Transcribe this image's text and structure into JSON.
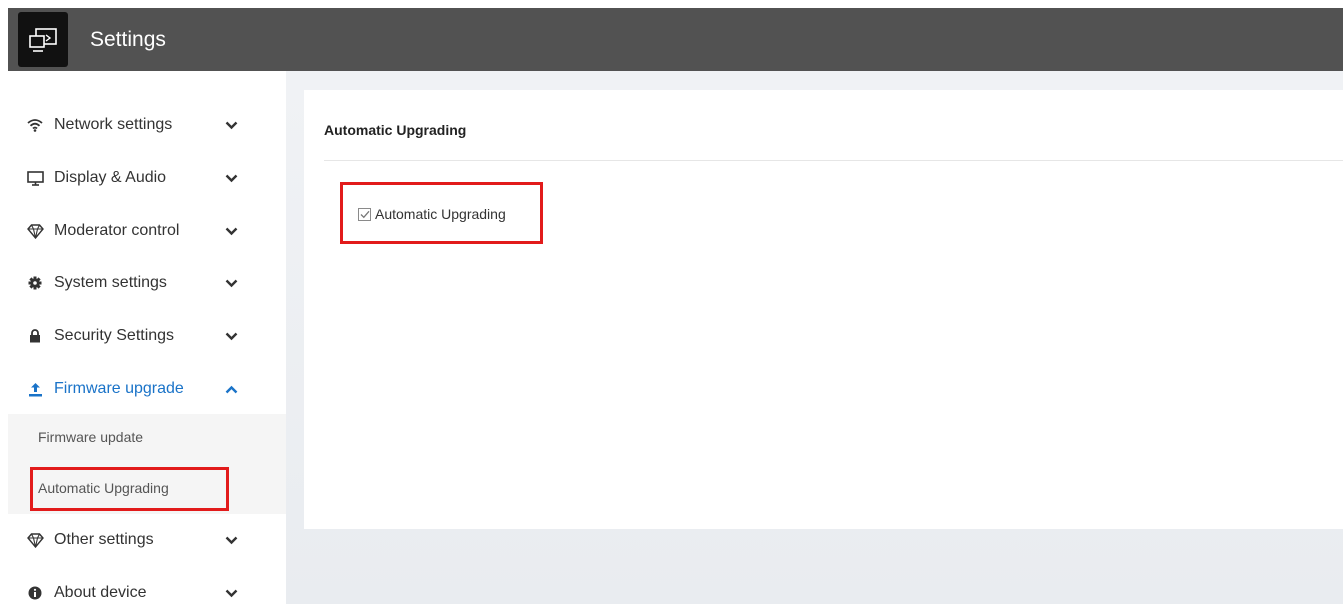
{
  "header": {
    "title": "Settings",
    "app_icon": "screen-share-icon",
    "background": "#525252"
  },
  "sidebar": {
    "items": [
      {
        "label": "Network settings",
        "icon": "wifi-icon",
        "expanded": false
      },
      {
        "label": "Display & Audio",
        "icon": "monitor-icon",
        "expanded": false
      },
      {
        "label": "Moderator control",
        "icon": "diamond-icon",
        "expanded": false
      },
      {
        "label": "System settings",
        "icon": "gear-icon",
        "expanded": false
      },
      {
        "label": "Security Settings",
        "icon": "lock-icon",
        "expanded": false
      },
      {
        "label": "Firmware upgrade",
        "icon": "upload-icon",
        "expanded": true
      },
      {
        "label": "Other settings",
        "icon": "diamond-icon",
        "expanded": false
      },
      {
        "label": "About device",
        "icon": "info-icon",
        "expanded": false
      }
    ],
    "subitems": [
      {
        "label": "Firmware update"
      },
      {
        "label": "Automatic Upgrading",
        "selected": true
      }
    ],
    "active_color": "#1a73c8"
  },
  "main": {
    "section_title": "Automatic Upgrading",
    "checkbox": {
      "label": "Automatic Upgrading",
      "checked": true
    }
  },
  "annotations": {
    "highlight_color": "#e21b1b"
  }
}
